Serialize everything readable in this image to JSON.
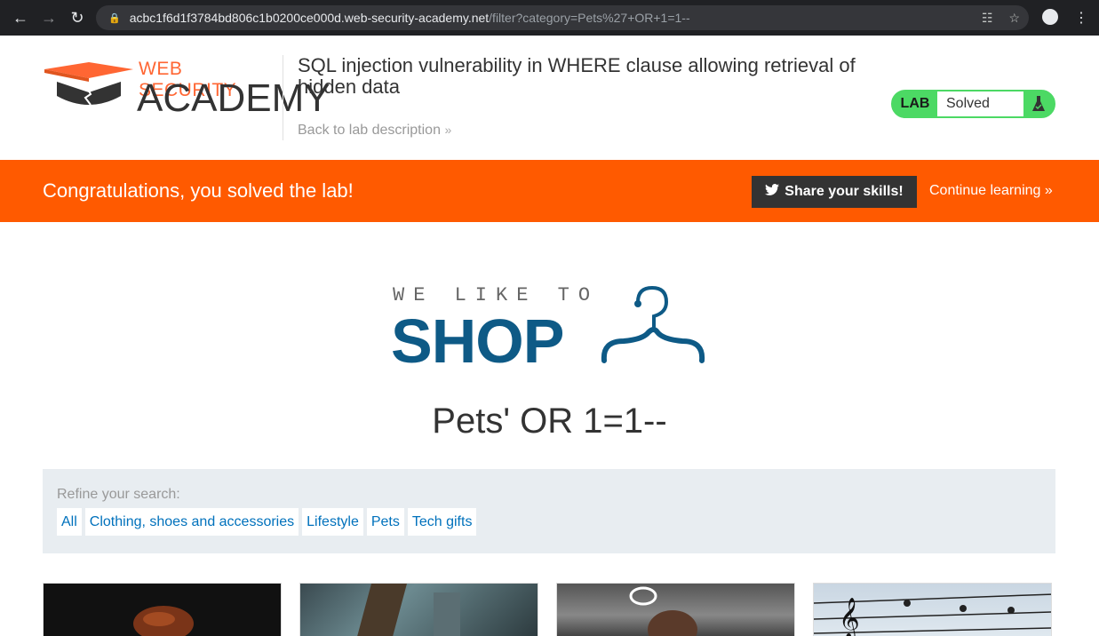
{
  "browser": {
    "url_host": "acbc1f6d1f3784bd806c1b0200ce000d.web-security-academy.net",
    "url_path": "/filter?category=Pets%27+OR+1=1--"
  },
  "header": {
    "logo_top": "WEB SECURITY",
    "logo_bottom": "ACADEMY",
    "lab_title": "SQL injection vulnerability in WHERE clause allowing retrieval of hidden data",
    "back_link": "Back to lab description",
    "lab_badge": "LAB",
    "lab_status": "Solved"
  },
  "banner": {
    "message": "Congratulations, you solved the lab!",
    "share_label": "Share your skills!",
    "continue_label": "Continue learning"
  },
  "shop": {
    "tagline": "WE LIKE TO",
    "name": "SHOP"
  },
  "category_title": "Pets' OR 1=1--",
  "filter": {
    "label": "Refine your search:",
    "categories": [
      "All",
      "Clothing, shoes and accessories",
      "Lifestyle",
      "Pets",
      "Tech gifts"
    ]
  },
  "colors": {
    "accent": "#ff5a00",
    "brand_blue": "#0e5a86",
    "link": "#0071bc",
    "solved_green": "#4cd964"
  }
}
